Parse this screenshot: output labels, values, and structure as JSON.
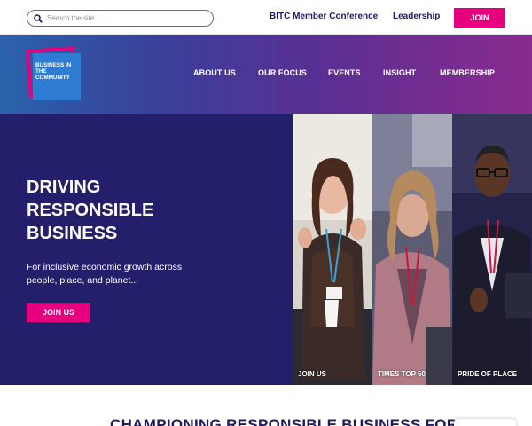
{
  "search": {
    "placeholder": "Search the site..."
  },
  "topnav": {
    "conference": "BITC Member Conference",
    "leadership": "Leadership",
    "join": "JOIN"
  },
  "logo": {
    "text": "BUSINESS IN THE COMMUNITY"
  },
  "mainnav": [
    "ABOUT US",
    "OUR FOCUS",
    "EVENTS",
    "INSIGHT",
    "MEMBERSHIP"
  ],
  "hero": {
    "title_lines": [
      "DRIVING",
      "RESPONSIBLE",
      "BUSINESS"
    ],
    "subtitle": "For inclusive economic growth across people, place, and planet...",
    "cta": "JOIN US"
  },
  "tiles": [
    {
      "label": "JOIN US"
    },
    {
      "label": "TIMES TOP 50"
    },
    {
      "label": "PRIDE OF PLACE"
    }
  ],
  "section": {
    "title": "CHAMPIONING RESPONSIBLE BUSINESS FOR"
  },
  "colors": {
    "accent": "#e6007e",
    "navy": "#231f6b",
    "blue": "#2f7cd3",
    "purple": "#8a2b8e"
  }
}
